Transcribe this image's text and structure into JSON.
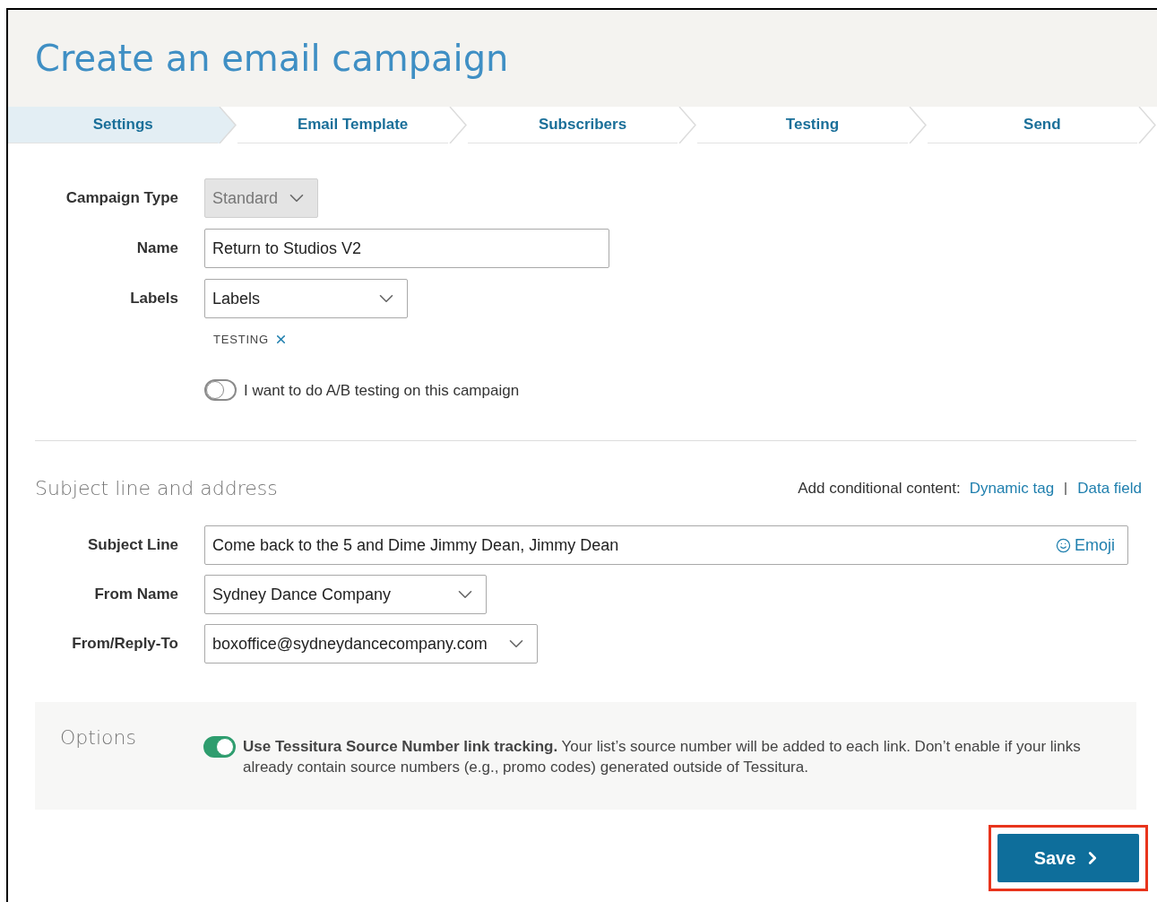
{
  "page": {
    "title": "Create an email campaign"
  },
  "steps": [
    {
      "label": "Settings",
      "selected": true
    },
    {
      "label": "Email Template",
      "selected": false
    },
    {
      "label": "Subscribers",
      "selected": false
    },
    {
      "label": "Testing",
      "selected": false
    },
    {
      "label": "Send",
      "selected": false
    }
  ],
  "settings": {
    "fields": [
      {
        "kind": "select",
        "label": "Campaign Type",
        "value": "Standard",
        "disabled": true
      },
      {
        "kind": "text",
        "label": "Name",
        "value": "Return to Studios V2"
      },
      {
        "kind": "select",
        "label": "Labels",
        "value": "Labels",
        "disabled": false
      }
    ],
    "tags": [
      "TESTING"
    ],
    "ab_testing": {
      "label": "I want to do A/B testing on this campaign",
      "on": false
    }
  },
  "subject_section": {
    "heading": "Subject line and address",
    "conditional_label": "Add conditional content:",
    "links": [
      "Dynamic tag",
      "Data field"
    ],
    "fields": [
      {
        "kind": "text",
        "label": "Subject Line",
        "value": "Come back to the 5 and Dime Jimmy Dean, Jimmy Dean",
        "action": "Emoji"
      },
      {
        "kind": "select",
        "label": "From Name",
        "value": "Sydney Dance Company",
        "disabled": false
      },
      {
        "kind": "select",
        "label": "From/Reply-To",
        "value": "boxoffice@sydneydancecompany.com",
        "disabled": false
      }
    ]
  },
  "options": {
    "heading": "Options",
    "tracking": {
      "on": true,
      "text": "**Use Tessitura Source Number link tracking.** Your list’s source number will be added to each link. Don’t enable if your links already contain source numbers (e.g., promo codes) generated outside of Tessitura."
    }
  },
  "save_button": {
    "label": "Save",
    "highlighted": true
  }
}
